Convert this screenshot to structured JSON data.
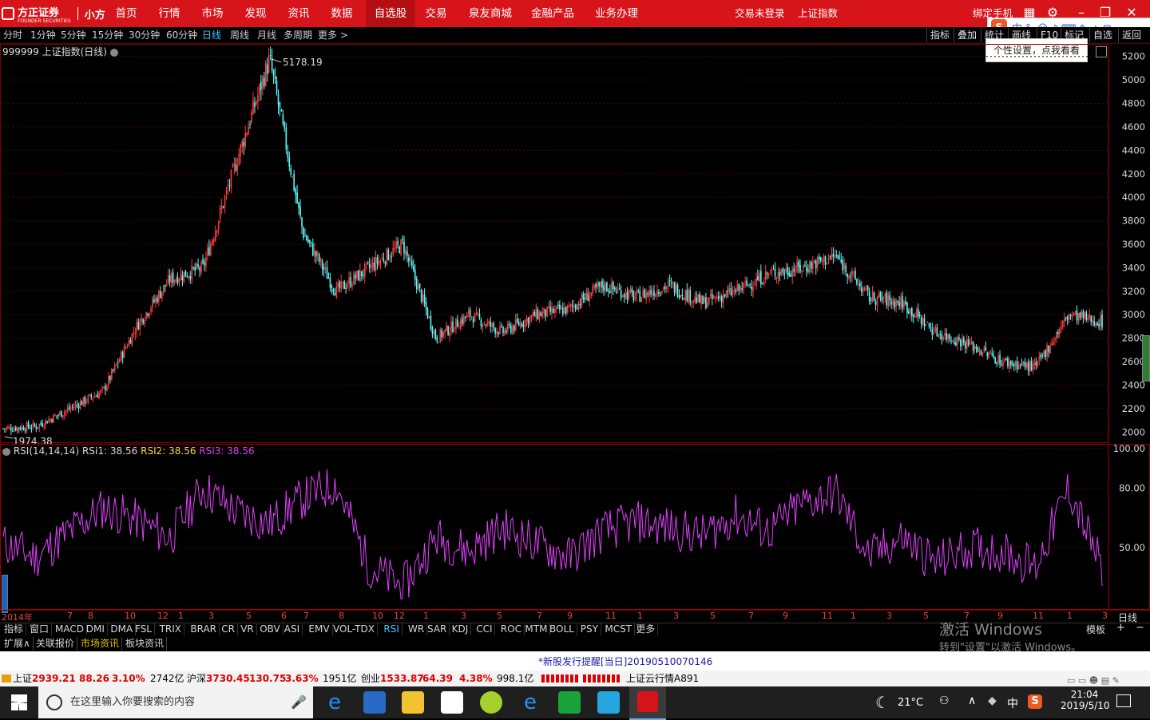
{
  "nav": {
    "logo": "方正证券",
    "logo_sub": "FOUNDER SECURITIES",
    "app": "小方",
    "items": [
      "首页",
      "行情",
      "市场",
      "发现",
      "资讯",
      "数据",
      "自选股",
      "交易",
      "泉友商城",
      "金融产品",
      "业务办理"
    ],
    "active": "自选股",
    "status": "交易未登录",
    "index": "上证指数",
    "bind_phone": "绑定手机"
  },
  "periods": [
    "分时",
    "1分钟",
    "5分钟",
    "15分钟",
    "30分钟",
    "60分钟",
    "日线",
    "周线",
    "月线",
    "多周期",
    "更多 >"
  ],
  "selected_period": "日线",
  "right_tools": [
    "指标",
    "叠加",
    "统计",
    "画线",
    "F10",
    "标记",
    "自选",
    "返回"
  ],
  "tooltip": "个性设置，点我看看",
  "chart_title": "999999 上证指数(日线)",
  "rsi_header": {
    "name": "RSI(14,14,14)",
    "rsi1": "RSI1: 38.56",
    "rsi2": "RSI2: 38.56",
    "rsi3": "RSI3: 38.56"
  },
  "annotations": {
    "high": "5178.19",
    "low": "1974.38"
  },
  "date_axis": [
    "2014年",
    "7",
    "8",
    "10",
    "12",
    "1",
    "3",
    "5",
    "6",
    "7",
    "8",
    "10",
    "12",
    "1",
    "3",
    "5",
    "7",
    "9",
    "11",
    "1",
    "3",
    "5",
    "7",
    "9",
    "11",
    "1",
    "3",
    "5",
    "7",
    "9",
    "11",
    "1",
    "3",
    "5"
  ],
  "period_label": "日线",
  "indicators": [
    "指标",
    "窗口",
    "MACD",
    "DMI",
    "DMA",
    "FSL",
    "TRIX",
    "BRAR",
    "CR",
    "VR",
    "OBV",
    "ASI",
    "EMV",
    "VOL-TDX",
    "RSI",
    "WR",
    "SAR",
    "KDJ",
    "CCI",
    "ROC",
    "MTM",
    "BOLL",
    "PSY",
    "MCST",
    "更多"
  ],
  "selected_indicator": "RSI",
  "template_label": "模板",
  "bottom_tabs": [
    "扩展∧",
    "关联报价",
    "市场资讯",
    "板块资讯"
  ],
  "notice": "*新股发行提醒[当日]20190510070146",
  "status": {
    "sh_label": "上证",
    "sh_value": "2939.21",
    "sh_change": "88.26",
    "sh_pct": "3.10%",
    "sh_amount": "2742亿",
    "hs_label": "沪深",
    "hs_value": "3730.45",
    "hs_change": "130.75",
    "hs_pct": "3.63%",
    "hs_amount": "1951亿",
    "cy_label": "创业",
    "cy_value": "1533.87",
    "cy_change": "64.39",
    "cy_pct": "4.38%",
    "cy_amount": "998.1亿",
    "cloud": "上证云行情A891"
  },
  "watermark": {
    "line1": "激活 Windows",
    "line2": "转到\"设置\"以激活 Windows。"
  },
  "taskbar": {
    "search_placeholder": "在这里输入你要搜索的内容",
    "weather": "21°C",
    "ime": "中",
    "time": "21:04",
    "date": "2019/5/10"
  },
  "colors": {
    "up": "#ff3b3b",
    "down": "#54ffff",
    "rsi": "#e040fb",
    "grid": "#5a0000",
    "nav": "#d7141a"
  },
  "chart_data": [
    {
      "type": "candlestick",
      "title": "999999 上证指数(日线)",
      "ylim": [
        1900,
        5300
      ],
      "yticks": [
        2000,
        2200,
        2400,
        2600,
        2800,
        3000,
        3200,
        3400,
        3600,
        3800,
        4000,
        4200,
        4400,
        4600,
        4800,
        5000,
        5200
      ],
      "x": [
        "2014-05",
        "2014-07",
        "2014-08",
        "2014-10",
        "2014-12",
        "2015-01",
        "2015-03",
        "2015-05",
        "2015-06",
        "2015-07",
        "2015-08",
        "2015-10",
        "2015-12",
        "2016-01",
        "2016-03",
        "2016-05",
        "2016-07",
        "2016-09",
        "2016-11",
        "2017-01",
        "2017-03",
        "2017-05",
        "2017-07",
        "2017-09",
        "2017-11",
        "2018-01",
        "2018-03",
        "2018-05",
        "2018-07",
        "2018-09",
        "2018-11",
        "2019-01",
        "2019-03",
        "2019-05"
      ],
      "close_approx": [
        2030,
        2050,
        2200,
        2350,
        2900,
        3300,
        3400,
        4300,
        5178,
        3700,
        3200,
        3400,
        3600,
        2800,
        3000,
        2850,
        3000,
        3050,
        3250,
        3150,
        3250,
        3100,
        3200,
        3350,
        3400,
        3500,
        3150,
        3100,
        2850,
        2750,
        2600,
        2550,
        3000,
        2939
      ],
      "high": 5178.19,
      "low": 1974.38
    },
    {
      "type": "line",
      "title": "RSI(14,14,14)",
      "ylim": [
        20,
        100
      ],
      "yticks": [
        50.0,
        80.0,
        100.0
      ],
      "series": [
        {
          "name": "RSI1",
          "values": [
            52,
            45,
            58,
            70,
            64,
            55,
            80,
            68,
            62,
            75,
            82,
            40,
            30,
            55,
            48,
            60,
            52,
            45,
            58,
            63,
            60,
            56,
            66,
            58,
            72,
            78,
            45,
            55,
            42,
            50,
            48,
            40,
            80,
            38.56
          ]
        }
      ]
    }
  ]
}
